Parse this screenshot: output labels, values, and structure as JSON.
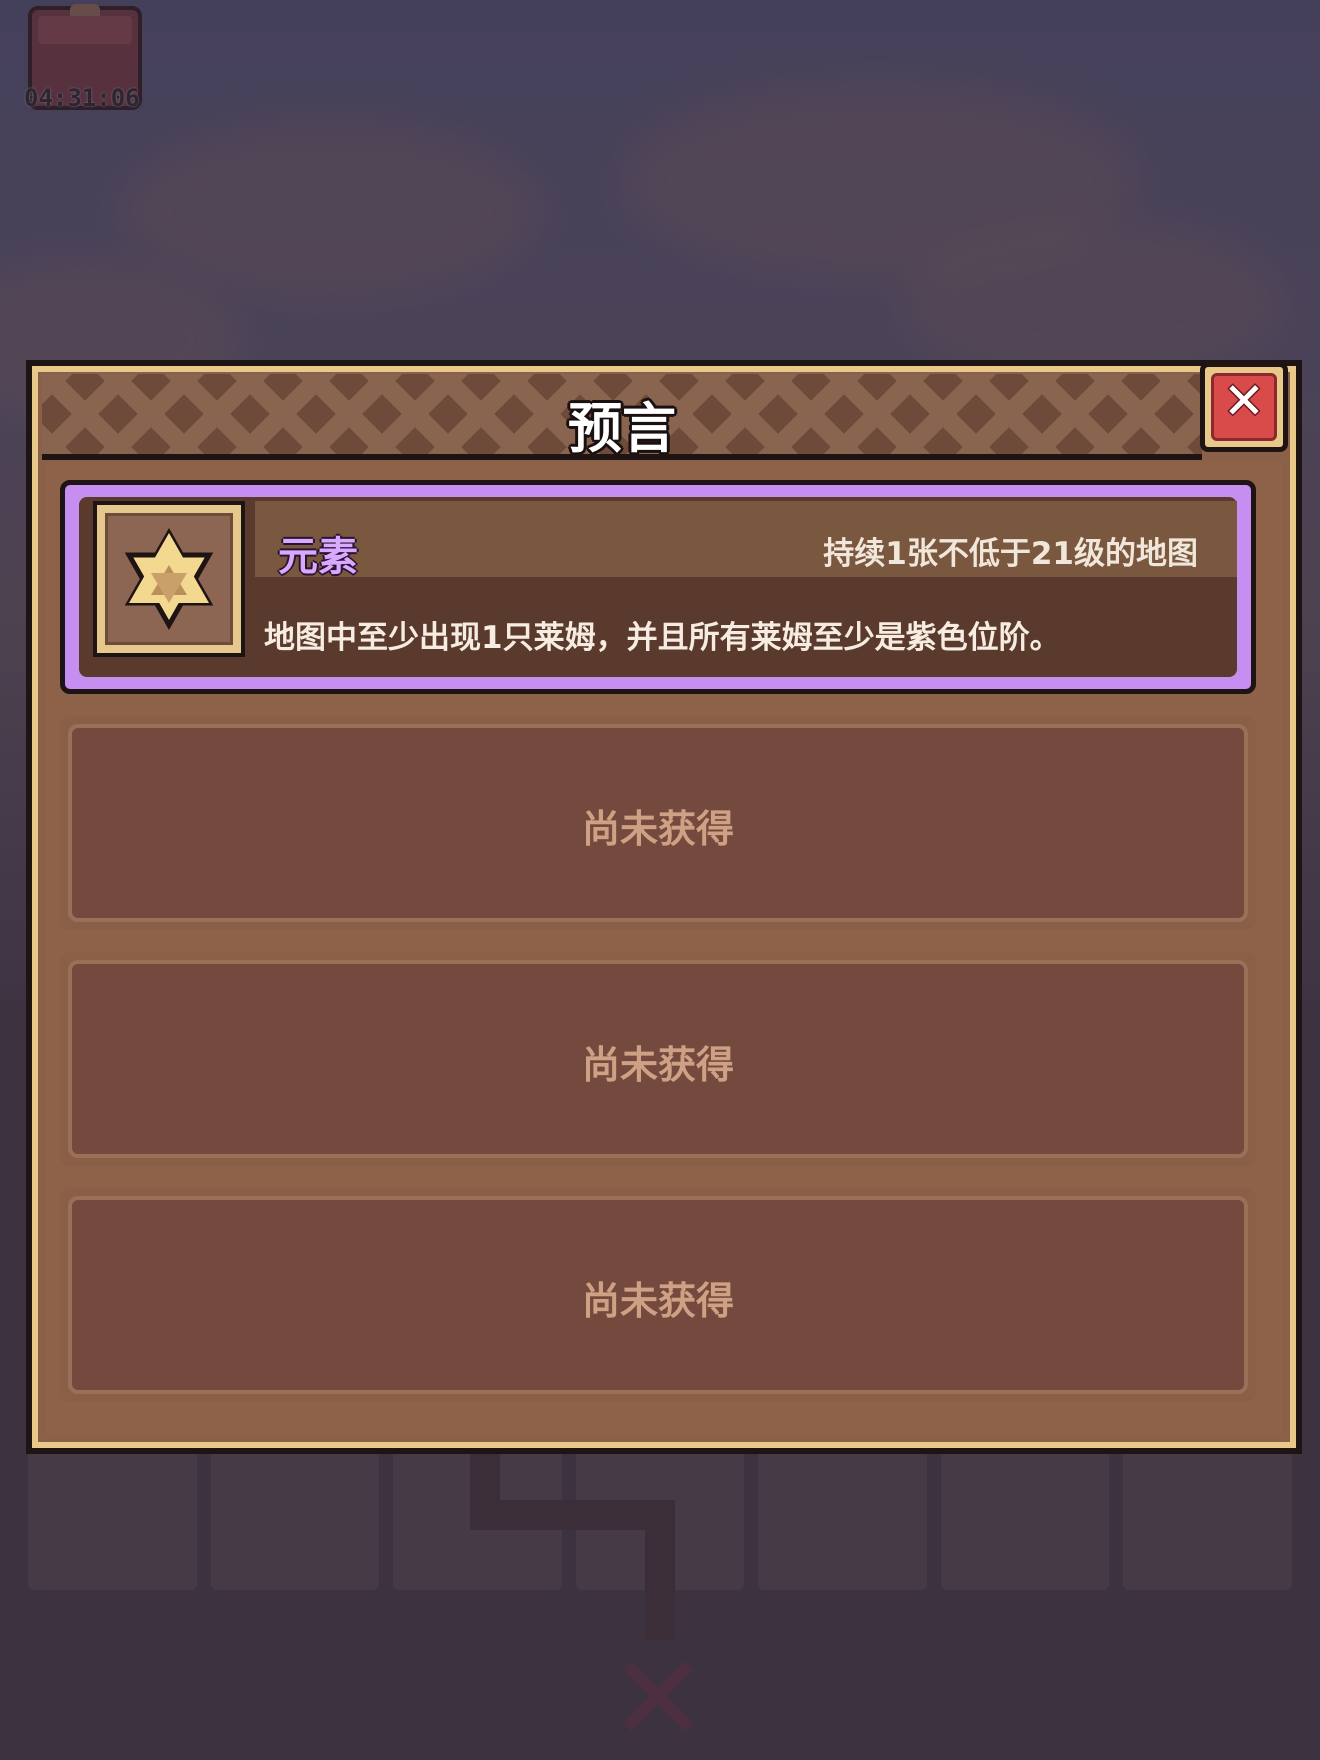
{
  "hud": {
    "timer": "04:31:06",
    "chest_icon": "gift-chest-icon"
  },
  "modal": {
    "title": "预言",
    "close_icon": "close-icon"
  },
  "prophecy_card": {
    "name": "元素",
    "condition": "持续1张不低于21级的地图",
    "description": "地图中至少出现1只莱姆，并且所有莱姆至少是紫色位阶。",
    "icon": "hexagram-star-icon",
    "rarity_color": "#c58ef0"
  },
  "empty_slots": [
    {
      "label": "尚未获得"
    },
    {
      "label": "尚未获得"
    },
    {
      "label": "尚未获得"
    }
  ]
}
